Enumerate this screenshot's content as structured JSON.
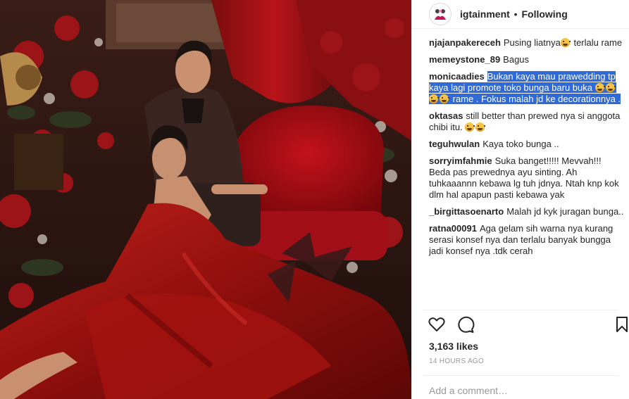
{
  "header": {
    "username": "igtainment",
    "separator": "•",
    "follow_status": "Following",
    "avatar_icon": "avatar-illustration-icon"
  },
  "comments": [
    {
      "user": "njajanpakereceh",
      "parts": [
        {
          "t": "Pusing liatnya"
        },
        {
          "emoji": "grimace-emoji"
        },
        {
          "t": " terlalu rame"
        }
      ]
    },
    {
      "user": "memeystone_89",
      "parts": [
        {
          "t": "Bagus"
        }
      ]
    },
    {
      "user": "monicaadies",
      "highlighted": true,
      "parts": [
        {
          "t": "Bukan kaya mau prawedding tp kaya lagi promote toko bunga baru buka "
        },
        {
          "emoji": "grimace-emoji"
        },
        {
          "emoji": "grimace-emoji"
        },
        {
          "emoji": "grimace-emoji"
        },
        {
          "emoji": "grimace-emoji"
        },
        {
          "t": " rame . Fokus malah jd ke decorationnya ."
        }
      ]
    },
    {
      "user": "oktasas",
      "parts": [
        {
          "t": "still better than prewed nya si anggota chibi itu. "
        },
        {
          "emoji": "grimace-emoji"
        },
        {
          "emoji": "grimace-emoji"
        }
      ]
    },
    {
      "user": "teguhwulan",
      "parts": [
        {
          "t": "Kaya toko bunga .."
        }
      ]
    },
    {
      "user": "sorryimfahmie",
      "parts": [
        {
          "t": "Suka banget!!!!! Mevvah!!! Beda pas prewednya ayu sinting. Ah tuhkaaannn kebawa lg tuh jdnya. Ntah knp kok dlm hal apapun pasti kebawa yak"
        }
      ]
    },
    {
      "user": "_birgittasoenarto",
      "parts": [
        {
          "t": "Malah jd kyk juragan bunga.."
        }
      ]
    },
    {
      "user": "ratna00091",
      "parts": [
        {
          "t": "Aga gelam sih warna nya kurang serasi konsef nya dan terlalu banyak bungga jadi konsef nya .tdk cerah"
        }
      ]
    }
  ],
  "actions": {
    "like_icon": "heart-icon",
    "comment_icon": "comment-bubble-icon",
    "save_icon": "bookmark-icon"
  },
  "likes": "3,163 likes",
  "timestamp": "14 HOURS AGO",
  "add_comment": {
    "placeholder": "Add a comment…"
  },
  "colors": {
    "highlight": "#2f6ad6",
    "text": "#262626",
    "muted": "#999999",
    "divider": "#efefef"
  }
}
